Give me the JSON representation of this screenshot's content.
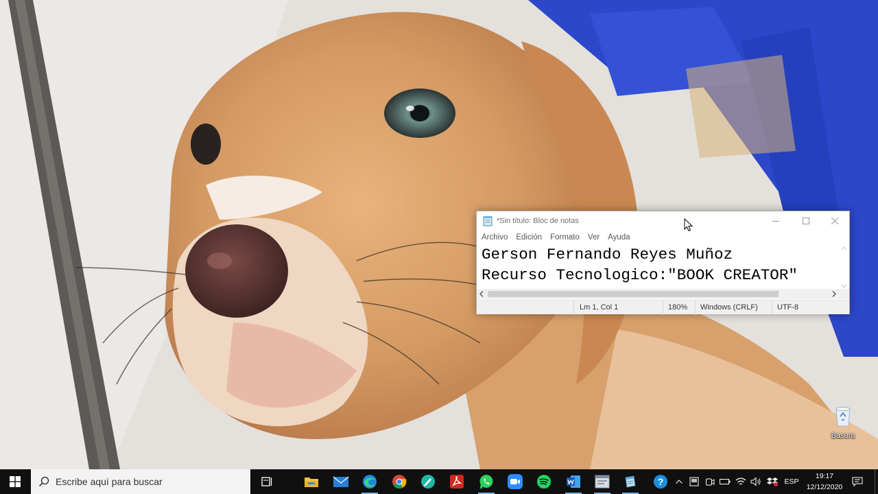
{
  "notepad": {
    "title": "*Sin título: Bloc de notas",
    "menu": [
      "Archivo",
      "Edición",
      "Formato",
      "Ver",
      "Ayuda"
    ],
    "lines": [
      "Gerson Fernando Reyes Muñoz",
      "Recurso Tecnologico:\"BOOK CREATOR\""
    ],
    "status": {
      "position": "Lm 1, Col 1",
      "zoom": "180%",
      "line_ending": "Windows (CRLF)",
      "encoding": "UTF-8"
    }
  },
  "desktop": {
    "recycle_bin_label": "Basura"
  },
  "taskbar": {
    "search_placeholder": "Escribe aquí para buscar",
    "pinned": [
      "task-view-icon",
      "file-explorer-icon",
      "mail-icon",
      "edge-icon",
      "chrome-icon",
      "sketch-app-icon",
      "acrobat-icon",
      "whatsapp-icon",
      "zoom-icon",
      "spotify-icon",
      "word-icon",
      "taskbar-app-icon",
      "notepad-icon"
    ],
    "tray": {
      "language": "ESP",
      "time": "19:17",
      "date": "12/12/2020"
    }
  },
  "colors": {
    "taskbar_bg": "#101010",
    "accent": "#7cb6f2",
    "notepad_bg": "#ffffff"
  }
}
